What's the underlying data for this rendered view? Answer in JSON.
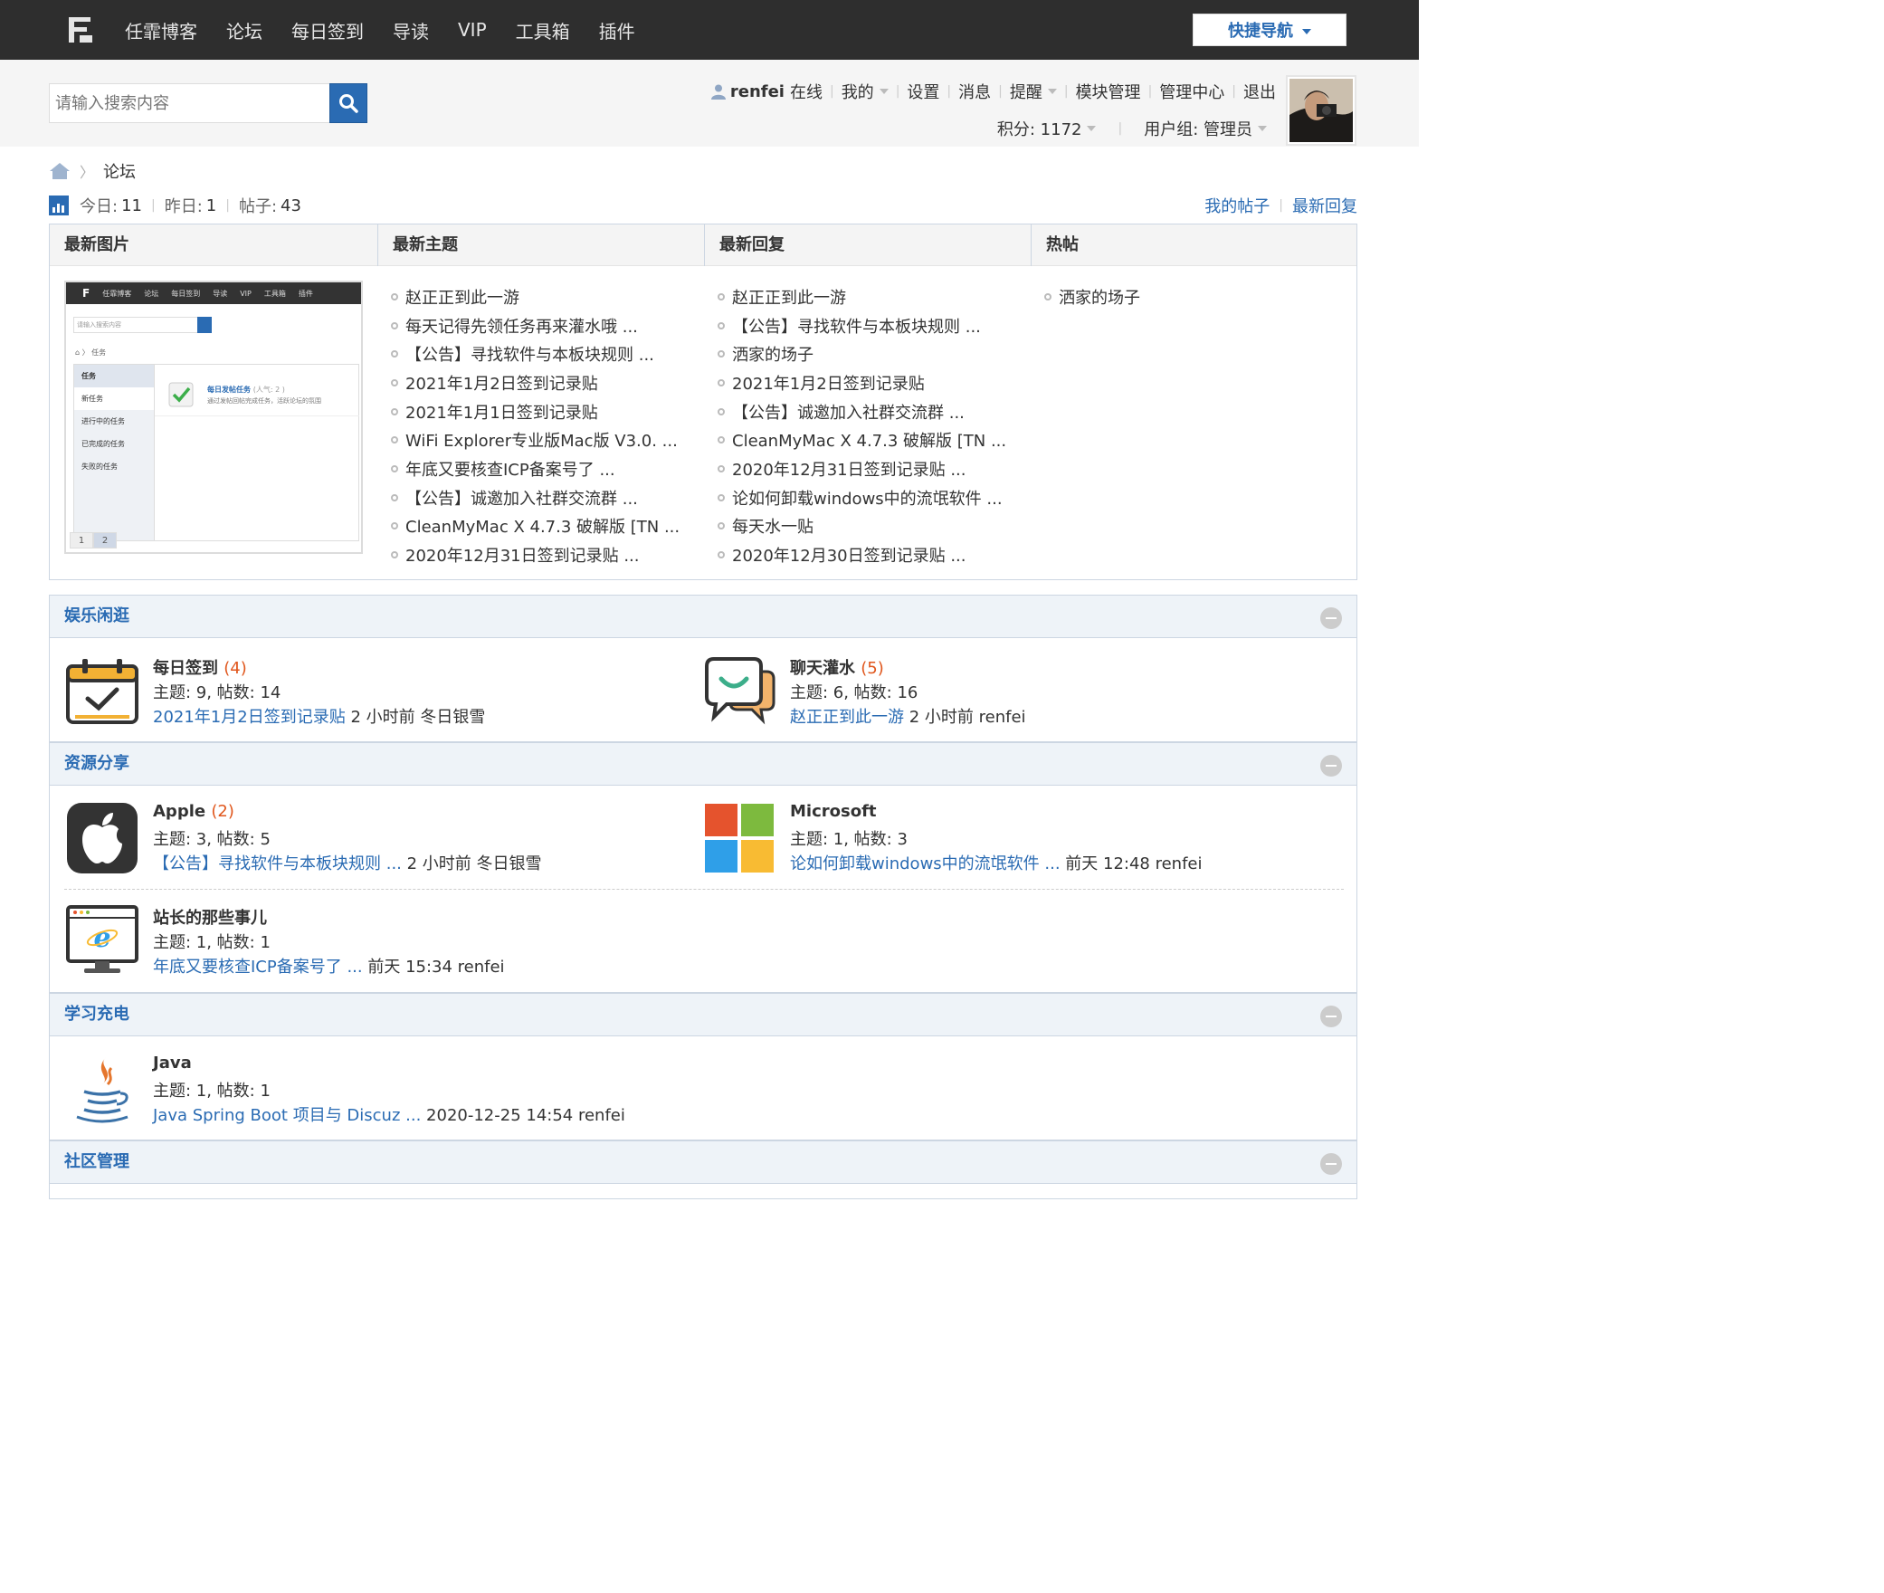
{
  "nav": {
    "items": [
      "任霏博客",
      "论坛",
      "每日签到",
      "导读",
      "VIP",
      "工具箱",
      "插件"
    ],
    "quicknav": "快捷导航"
  },
  "search": {
    "placeholder": "请输入搜索内容"
  },
  "user": {
    "name": "renfei",
    "status": "在线",
    "links": [
      "我的",
      "设置",
      "消息",
      "提醒",
      "模块管理",
      "管理中心",
      "退出"
    ],
    "score_label": "积分: 1172",
    "group_label": "用户组: 管理员"
  },
  "breadcrumb": {
    "current": "论坛"
  },
  "stats": {
    "today_label": "今日:",
    "today": "11",
    "yesterday_label": "昨日:",
    "yesterday": "1",
    "posts_label": "帖子:",
    "posts": "43"
  },
  "quicklinks": [
    "我的帖子",
    "最新回复"
  ],
  "grid": {
    "headers": [
      "最新图片",
      "最新主题",
      "最新回复",
      "热帖"
    ],
    "latest_topics": [
      "赵正正到此一游",
      "每天记得先领任务再来灌水哦 ...",
      "【公告】寻找软件与本板块规则 ...",
      "2021年1月2日签到记录贴",
      "2021年1月1日签到记录贴",
      "WiFi Explorer专业版Mac版 V3.0. ...",
      "年底又要核查ICP备案号了 ...",
      "【公告】诚邀加入社群交流群 ...",
      "CleanMyMac X 4.7.3 破解版 [TN ...",
      "2020年12月31日签到记录贴 ..."
    ],
    "latest_replies": [
      "赵正正到此一游",
      "【公告】寻找软件与本板块规则 ...",
      "洒家的场子",
      "2021年1月2日签到记录贴",
      "【公告】诚邀加入社群交流群 ...",
      "CleanMyMac X 4.7.3 破解版 [TN ...",
      "2020年12月31日签到记录贴 ...",
      "论如何卸载windows中的流氓软件 ...",
      "每天水一贴",
      "2020年12月30日签到记录贴 ..."
    ],
    "hot": [
      "洒家的场子"
    ],
    "thumb": {
      "nav": [
        "任霏博客",
        "论坛",
        "每日签到",
        "导读",
        "VIP",
        "工具箱",
        "插件"
      ],
      "search": "请输入搜索内容",
      "crumb": "任务",
      "side": [
        "任务",
        "新任务",
        "进行中的任务",
        "已完成的任务",
        "失败的任务"
      ],
      "task_title": "每日发帖任务",
      "task_pop": "(人气: 2 )",
      "task_desc": "通过发帖回帖完成任务，活跃论坛的氛围",
      "pages": [
        "1",
        "2"
      ]
    }
  },
  "sections": [
    {
      "title": "娱乐闲逛",
      "forums": [
        {
          "name": "每日签到",
          "count": "(4)",
          "meta": "主题: 9, 帖数: 14",
          "last_link": "2021年1月2日签到记录贴",
          "last_info": " 2 小时前 冬日银雪",
          "icon": "calendar-check-icon"
        },
        {
          "name": "聊天灌水",
          "count": "(5)",
          "meta": "主题: 6, 帖数: 16",
          "last_link": "赵正正到此一游",
          "last_info": " 2 小时前 renfei",
          "icon": "chat-bubbles-icon"
        }
      ]
    },
    {
      "title": "资源分享",
      "forums": [
        {
          "name": "Apple",
          "count": "(2)",
          "meta": "主题: 3, 帖数: 5",
          "last_link": "【公告】寻找软件与本板块规则 ...",
          "last_info": " 2 小时前 冬日银雪",
          "icon": "apple-icon"
        },
        {
          "name": "Microsoft",
          "count": "",
          "meta": "主题: 1, 帖数: 3",
          "last_link": "论如何卸载windows中的流氓软件 ...",
          "last_info": " 前天 12:48 renfei",
          "icon": "microsoft-icon"
        },
        {
          "name": "站长的那些事儿",
          "count": "",
          "meta": "主题: 1, 帖数: 1",
          "last_link": "年底又要核查ICP备案号了 ...",
          "last_info": " 前天 15:34 renfei",
          "icon": "ie-monitor-icon"
        }
      ]
    },
    {
      "title": "学习充电",
      "forums": [
        {
          "name": "Java",
          "count": "",
          "meta": "主题: 1, 帖数: 1",
          "last_link": "Java Spring Boot 项目与 Discuz ...",
          "last_info": " 2020-12-25 14:54 renfei",
          "icon": "java-icon"
        }
      ]
    },
    {
      "title": "社区管理",
      "forums": []
    }
  ],
  "colors": {
    "accent": "#2a6bb3",
    "count": "#e0561c",
    "topbar": "#2e2e2e"
  }
}
